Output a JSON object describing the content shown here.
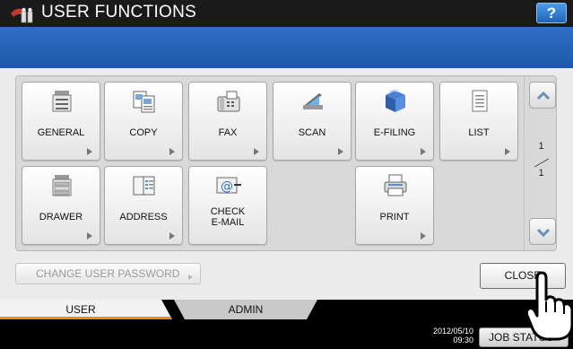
{
  "header": {
    "title": "USER FUNCTIONS",
    "help_label": "?"
  },
  "tiles": [
    {
      "label": "GENERAL",
      "icon": "copier-icon"
    },
    {
      "label": "COPY",
      "icon": "copy-pages-icon"
    },
    {
      "label": "FAX",
      "icon": "fax-icon"
    },
    {
      "label": "SCAN",
      "icon": "scanner-icon"
    },
    {
      "label": "E-FILING",
      "icon": "efiling-box-icon"
    },
    {
      "label": "LIST",
      "icon": "list-document-icon"
    },
    {
      "label": "DRAWER",
      "icon": "drawer-copier-icon"
    },
    {
      "label": "ADDRESS",
      "icon": "address-book-icon"
    },
    {
      "label": "CHECK\nE-MAIL",
      "icon": "email-at-icon"
    },
    {
      "label": "PRINT",
      "icon": "printer-icon"
    }
  ],
  "pager": {
    "current": "1",
    "total": "1"
  },
  "buttons": {
    "change_password": "CHANGE USER PASSWORD",
    "close": "CLOSE"
  },
  "tabs": [
    {
      "label": "USER",
      "active": true
    },
    {
      "label": "ADMIN",
      "active": false
    }
  ],
  "footer": {
    "date": "2012/05/10",
    "time": "09:30",
    "job_status": "JOB STATUS"
  },
  "colors": {
    "accent_blue": "#2f6fc6",
    "tab_active_underline": "#ee8a1b"
  }
}
